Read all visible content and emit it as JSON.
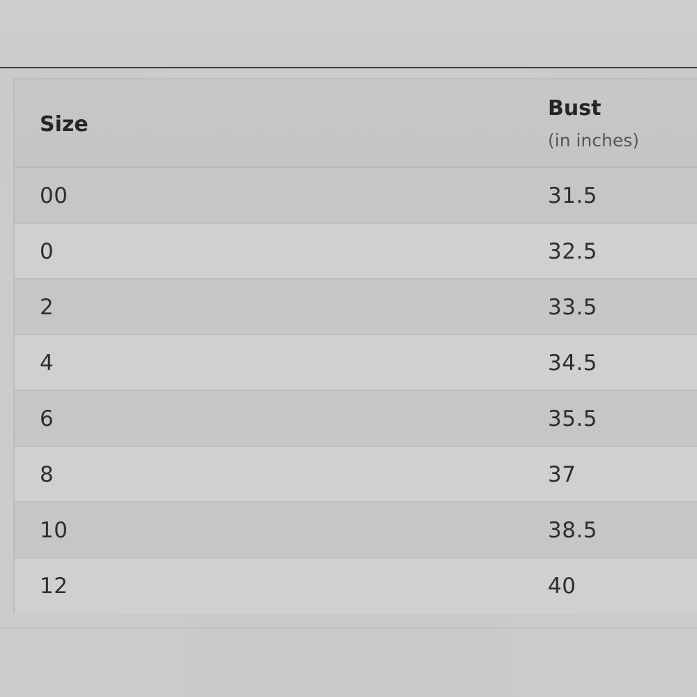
{
  "size_chart": {
    "columns": {
      "size": "Size",
      "bust": "Bust",
      "bust_unit": "(in inches)"
    },
    "rows": [
      {
        "size": "00",
        "bust": "31.5"
      },
      {
        "size": "0",
        "bust": "32.5"
      },
      {
        "size": "2",
        "bust": "33.5"
      },
      {
        "size": "4",
        "bust": "34.5"
      },
      {
        "size": "6",
        "bust": "35.5"
      },
      {
        "size": "8",
        "bust": "37"
      },
      {
        "size": "10",
        "bust": "38.5"
      },
      {
        "size": "12",
        "bust": "40"
      }
    ]
  }
}
